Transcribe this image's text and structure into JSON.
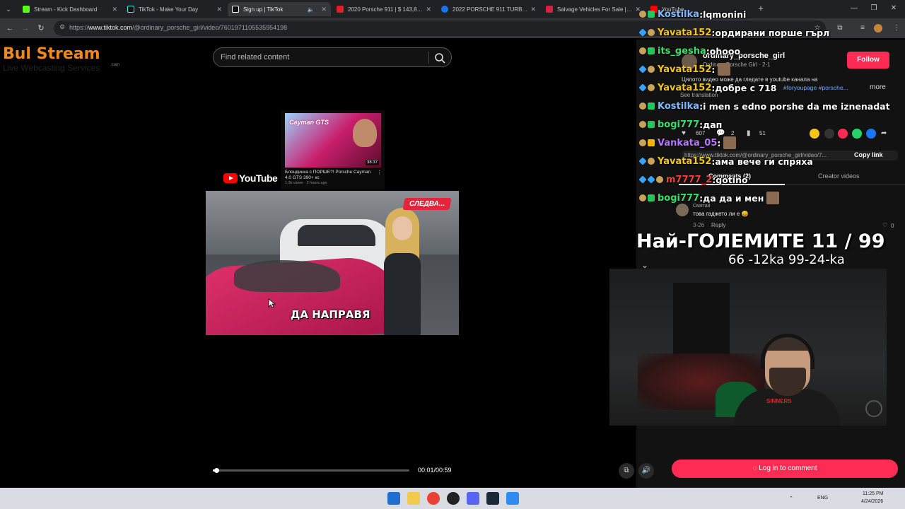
{
  "browser": {
    "tabs": [
      {
        "label": "Stream - Kick Dashboard",
        "color": "#53fc18",
        "active": false
      },
      {
        "label": "TikTok - Make Your Day",
        "color": "#25f4ee",
        "active": false
      },
      {
        "label": "Sign up | TikTok",
        "color": "#ffffff",
        "active": true
      },
      {
        "label": "2020 Porsche 911 | $ 143,898 | E",
        "color": "#e31d2a",
        "active": false
      },
      {
        "label": "2022 PORSCHE 911 TURBO | E",
        "color": "#1a73e8",
        "active": false
      },
      {
        "label": "Salvage Vehicles For Sale | IAA",
        "color": "#d6223b",
        "active": false
      },
      {
        "label": "YouTube",
        "color": "#ff0000",
        "active": false
      }
    ],
    "url_prefix": "https://",
    "url_host": "www.tiktok.com",
    "url_path": "/@ordinary_porsche_girl/video/7601971105535954198"
  },
  "overlay": {
    "logo_main": "Bul Stream",
    "logo_sub": "Live Webcasting Services",
    "logo_dotcom": ".com"
  },
  "tiktok": {
    "search_placeholder": "Find related content",
    "yt_card": {
      "thumb_title": "Cayman GTS",
      "duration": "38:37",
      "title": "Блондинка с ПОРШЕ?! Porsche Cayman 4.0 GTS 390+ кс",
      "meta": "1.3k views · 2 hours ago",
      "brand": "YouTube"
    },
    "video_next_label": "СЛЕДВА...",
    "video_caption": "ДА НАПРАВЯ",
    "progress_percent": 1.7,
    "time": "00:01/00:59"
  },
  "right_panel": {
    "username": "ordinary_porsche_girl",
    "display": "Ordinary Porsche Girl · 2-1",
    "follow": "Follow",
    "description": "Цялото видео може да гледате в youtube канала на",
    "hashtags": "#foryoupage #porsche...",
    "more": "more",
    "see_translation": "See translation",
    "likes": "607",
    "comments_count": "2",
    "saves": "51",
    "share_link": "https://www.tiktok.com/@ordinary_porsche_girl/video/7...",
    "copy_link": "Copy link",
    "comments_tab": "Comments (2)",
    "creator_tab": "Creator videos",
    "comment_user": "Смятай",
    "comment_text": "това гаджето ли е 😄",
    "comment_date": "3-26",
    "reply": "Reply",
    "comment_likes": "0",
    "login_comment": "Log in to comment"
  },
  "chat": [
    {
      "user": "Kostilka",
      "color": "#7fb6ff",
      "msg": "lqmonini",
      "badges": [
        "circle",
        "green"
      ]
    },
    {
      "user": "Yavata152",
      "color": "#f5c518",
      "msg": "ордирани порше гърл",
      "badges": [
        "blue",
        "circle"
      ]
    },
    {
      "user": "its_gesha",
      "color": "#35e06b",
      "msg": "ohooo",
      "badges": [
        "circle",
        "green"
      ]
    },
    {
      "user": "Yavata152",
      "color": "#f5c518",
      "msg": "",
      "badges": [
        "blue",
        "circle"
      ]
    },
    {
      "user": "Yavata152",
      "color": "#f5c518",
      "msg": "добре с 718",
      "badges": [
        "blue",
        "circle"
      ]
    },
    {
      "user": "Kostilka",
      "color": "#7fb6ff",
      "msg": "i men s edno porshe da me iznenadat",
      "badges": [
        "circle",
        "green"
      ]
    },
    {
      "user": "bogi777",
      "color": "#35e06b",
      "msg": "дап",
      "badges": [
        "circle",
        "green"
      ]
    },
    {
      "user": "Vankata_05",
      "color": "#b776ff",
      "msg": "",
      "badges": [
        "circle",
        "gold"
      ]
    },
    {
      "user": "Yavata152",
      "color": "#f5c518",
      "msg": "ама вече ги спряха",
      "badges": [
        "blue",
        "circle"
      ]
    },
    {
      "user": "m7777_2",
      "color": "#ff3b3b",
      "msg": "gotino",
      "badges": [
        "blue",
        "blue",
        "circle"
      ]
    },
    {
      "user": "bogi777",
      "color": "#35e06b",
      "msg": "да да и мен",
      "badges": [
        "circle",
        "green"
      ]
    }
  ],
  "counter": {
    "title": "Най-ГОЛЕМИТЕ 11 / 99",
    "sub": "66 -12ka 99-24-ka"
  },
  "webcam": {
    "shirt_text": "SINNERS"
  },
  "taskbar": {
    "lang": "ENG",
    "time": "11:25 PM",
    "date": "4/24/2026"
  }
}
